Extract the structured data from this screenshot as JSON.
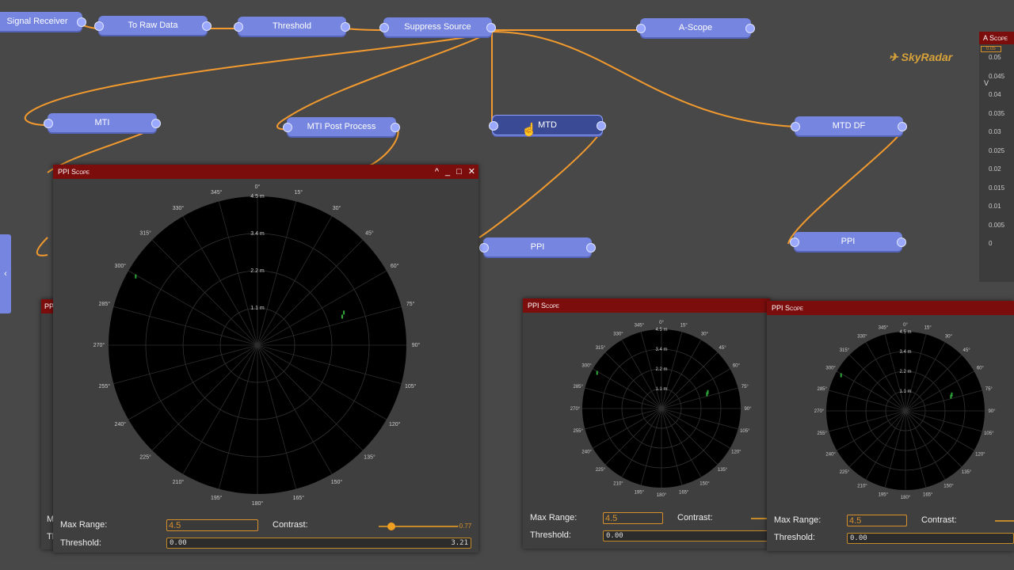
{
  "graph": {
    "nodes": [
      {
        "id": "signal-receiver",
        "label": "Signal Receiver"
      },
      {
        "id": "to-raw-data",
        "label": "To Raw Data"
      },
      {
        "id": "threshold",
        "label": "Threshold"
      },
      {
        "id": "suppress-source",
        "label": "Suppress Source"
      },
      {
        "id": "a-scope",
        "label": "A-Scope"
      },
      {
        "id": "mti",
        "label": "MTI"
      },
      {
        "id": "mti-post",
        "label": "MTI Post Process"
      },
      {
        "id": "mtd",
        "label": "MTD"
      },
      {
        "id": "mtd-df",
        "label": "MTD DF"
      },
      {
        "id": "ppi-1",
        "label": "PPI"
      },
      {
        "id": "ppi-2",
        "label": "PPI"
      }
    ]
  },
  "logo": {
    "text": "SkyRadar"
  },
  "ascope": {
    "title": "A Scope",
    "top_value": "0.05",
    "ylabel": "V",
    "ticks": [
      "0.05",
      "0.045",
      "0.04",
      "0.035",
      "0.03",
      "0.025",
      "0.02",
      "0.015",
      "0.01",
      "0.005",
      "0"
    ]
  },
  "ppi": {
    "title": "PPI Scope",
    "angles": [
      "0°",
      "15°",
      "30°",
      "45°",
      "60°",
      "75°",
      "90°",
      "105°",
      "120°",
      "135°",
      "150°",
      "165°",
      "180°",
      "195°",
      "210°",
      "225°",
      "240°",
      "255°",
      "270°",
      "285°",
      "300°",
      "315°",
      "330°",
      "345°"
    ],
    "rings": [
      "1.1 m",
      "2.2 m",
      "3.4 m",
      "4.5 m"
    ],
    "max_range_label": "Max Range:",
    "max_range_value": "4.5",
    "contrast_label": "Contrast:",
    "contrast_value": "-0.77",
    "threshold_label": "Threshold:",
    "threshold_min": "0.00",
    "threshold_max": "3.21",
    "controls": {
      "collapse": "^",
      "minimize": "_",
      "maximize": "□",
      "close": "✕"
    }
  },
  "partial_labels": {
    "m": "M",
    "th": "Th",
    "pp": "PP"
  },
  "side_tab": "‹",
  "colors": {
    "node": "#7585e0",
    "edge": "#f29a2e",
    "titlebar": "#7c0d0d",
    "accent": "#d8912a"
  }
}
